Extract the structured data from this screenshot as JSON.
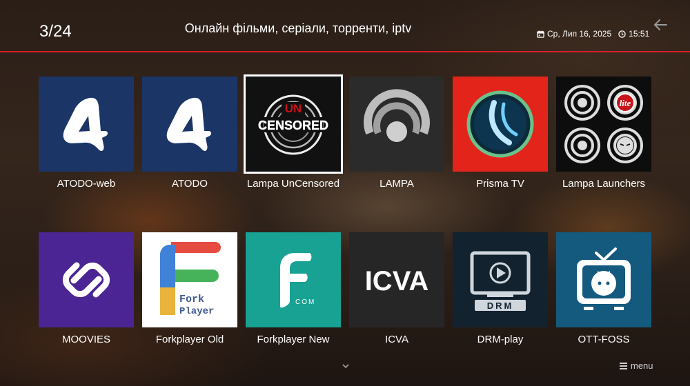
{
  "header": {
    "counter": "3/24",
    "title": "Онлайн фільми, серіали, торренти, iptv",
    "date": "Ср, Лип 16, 2025",
    "time": "15:51"
  },
  "apps": [
    {
      "label": "ATODO-web",
      "icon": "atodo-web-icon",
      "bg": "#1b3566"
    },
    {
      "label": "ATODO",
      "icon": "atodo-icon",
      "bg": "#1b3566"
    },
    {
      "label": "Lampa UnCensored",
      "icon": "lampa-uncensored-icon",
      "bg": "#111111",
      "selected": true
    },
    {
      "label": "LAMPA",
      "icon": "lampa-icon",
      "bg": "#2b2b2b"
    },
    {
      "label": "Prisma TV",
      "icon": "prisma-tv-icon",
      "bg": "#e3241b"
    },
    {
      "label": "Lampa Launchers",
      "icon": "lampa-launchers-icon",
      "bg": "#0d0d0d"
    },
    {
      "label": "MOOVIES",
      "icon": "moovies-icon",
      "bg": "#4a2593"
    },
    {
      "label": "Forkplayer Old",
      "icon": "forkplayer-old-icon",
      "bg": "#ffffff"
    },
    {
      "label": "Forkplayer New",
      "icon": "forkplayer-new-icon",
      "bg": "#17a293"
    },
    {
      "label": "ICVA",
      "icon": "icva-icon",
      "bg": "#262626"
    },
    {
      "label": "DRM-play",
      "icon": "drm-play-icon",
      "bg": "#12222f"
    },
    {
      "label": "OTT-FOSS",
      "icon": "ott-foss-icon",
      "bg": "#145a7e"
    }
  ],
  "logos": {
    "uncensored_top": "UN",
    "uncensored_bottom": "CENSORED",
    "lampa_launchers_badge": "lite",
    "forkplayer_old_text_1": "Fork",
    "forkplayer_old_text_2": "Player",
    "forkplayer_new_sub": "COM",
    "icva_text": "ICVA",
    "drm_text": "DRM"
  },
  "footer": {
    "menu_label": "menu"
  },
  "colors": {
    "accent_line": "#d81f26"
  }
}
